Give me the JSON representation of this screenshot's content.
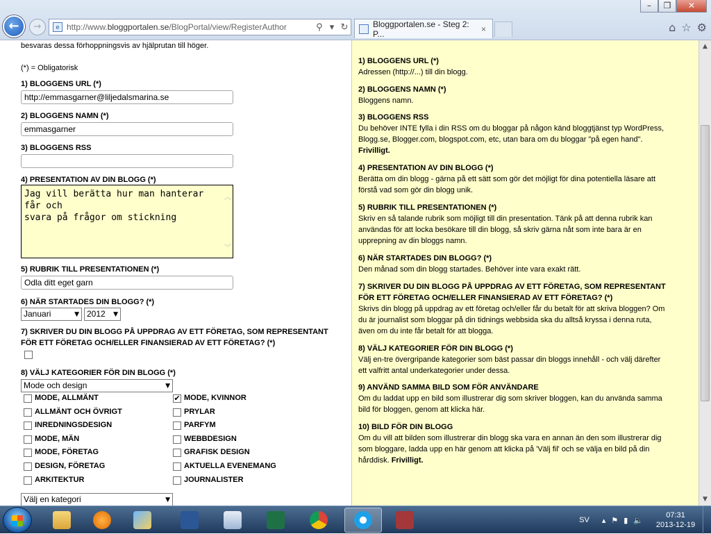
{
  "browser": {
    "url_prefix": "http://www.",
    "url_host": "bloggportalen.se",
    "url_path": "/BlogPortal/view/RegisterAuthor",
    "tab_title": "Bloggportalen.se - Steg 2: P...",
    "tab_close": "×"
  },
  "form": {
    "intro": "besvaras dessa förhoppningsvis av hjälprutan till höger.",
    "required_note": "(*) = Obligatorisk",
    "url_label": "1) BLOGGENS URL (*)",
    "url_value": "http://emmasgarner@liljedalsmarina.se",
    "name_label": "2) BLOGGENS NAMN (*)",
    "name_value": "emmasgarner",
    "rss_label": "3) BLOGGENS RSS",
    "rss_value": "",
    "presentation_label": "4) PRESENTATION AV DIN BLOGG (*)",
    "presentation_value": "Jag vill berätta hur man hanterar får och\nsvara på frågor om stickning",
    "title_label": "5) RUBRIK TILL PRESENTATIONEN (*)",
    "title_value": "Odla ditt eget garn",
    "started_label": "6) NÄR STARTADES DIN BLOGG? (*)",
    "month_value": "Januari",
    "year_value": "2012",
    "company_label_1": "7) SKRIVER DU DIN BLOGG PÅ UPPDRAG AV ETT FÖRETAG, SOM REPRESENTANT",
    "company_label_2": "FÖR ETT FÖRETAG OCH/ELLER FINANSIERAD AV ETT FÖRETAG? (*)",
    "categories_label": "8) VÄLJ KATEGORIER FÖR DIN BLOGG (*)",
    "main_category": "Mode och design",
    "subcategories": [
      {
        "label": "MODE, ALLMÄNT",
        "checked": false
      },
      {
        "label": "MODE, KVINNOR",
        "checked": true
      },
      {
        "label": "ALLMÄNT OCH ÖVRIGT",
        "checked": false
      },
      {
        "label": "PRYLAR",
        "checked": false
      },
      {
        "label": "INREDNINGSDESIGN",
        "checked": false
      },
      {
        "label": "PARFYM",
        "checked": false
      },
      {
        "label": "MODE, MÄN",
        "checked": false
      },
      {
        "label": "WEBBDESIGN",
        "checked": false
      },
      {
        "label": "MODE, FÖRETAG",
        "checked": false
      },
      {
        "label": "GRAFISK DESIGN",
        "checked": false
      },
      {
        "label": "DESIGN, FÖRETAG",
        "checked": false
      },
      {
        "label": "AKTUELLA EVENEMANG",
        "checked": false
      },
      {
        "label": "ARKITEKTUR",
        "checked": false
      },
      {
        "label": "JOURNALISTER",
        "checked": false
      }
    ],
    "choose_category": "Välj en kategori"
  },
  "help": [
    {
      "heading": "1) BLOGGENS URL (*)",
      "body": "Adressen (http://...) till din blogg.",
      "bold_tail": ""
    },
    {
      "heading": "2) BLOGGENS NAMN (*)",
      "body": "Bloggens namn.",
      "bold_tail": ""
    },
    {
      "heading": "3) BLOGGENS RSS",
      "body": "Du behöver INTE fylla i din RSS om du bloggar på någon känd bloggtjänst typ WordPress, Blogg.se, Blogger.com, blogspot.com, etc, utan bara om du bloggar \"på egen hand\". ",
      "bold_tail": "Frivilligt."
    },
    {
      "heading": "4) PRESENTATION AV DIN BLOGG (*)",
      "body": "Berätta om din blogg - gärna på ett sätt som gör det möjligt för dina potentiella läsare att förstå vad som gör din blogg unik.",
      "bold_tail": ""
    },
    {
      "heading": "5) RUBRIK TILL PRESENTATIONEN (*)",
      "body": "Skriv en så talande rubrik som möjligt till din presentation. Tänk på att denna rubrik kan användas för att locka besökare till din blogg, så skriv gärna nåt som inte bara är en upprepning av din bloggs namn.",
      "bold_tail": ""
    },
    {
      "heading": "6) NÄR STARTADES DIN BLOGG? (*)",
      "body": "Den månad som din blogg startades. Behöver inte vara exakt rätt.",
      "bold_tail": ""
    },
    {
      "heading": "7) SKRIVER DU DIN BLOGG PÅ UPPDRAG AV ETT FÖRETAG, SOM REPRESENTANT FÖR ETT FÖRETAG OCH/ELLER FINANSIERAD AV ETT FÖRETAG? (*)",
      "body": "Skrivs din blogg på uppdrag av ett företag och/eller får du betalt för att skriva bloggen? Om du är journalist som bloggar på din tidnings webbsida ska du alltså kryssa i denna ruta, även om du inte får betalt för att blogga.",
      "bold_tail": ""
    },
    {
      "heading": "8) VÄLJ KATEGORIER FÖR DIN BLOGG (*)",
      "body": "Välj en-tre övergripande kategorier som bäst passar din bloggs innehåll - och välj därefter ett valfritt antal underkategorier under dessa.",
      "bold_tail": ""
    },
    {
      "heading": "9) ANVÄND SAMMA BILD SOM FÖR ANVÄNDARE",
      "body": "Om du laddat upp en bild som illustrerar dig som skriver bloggen, kan du använda samma bild för bloggen, genom att klicka här.",
      "bold_tail": ""
    },
    {
      "heading": "10) BILD FÖR DIN BLOGG",
      "body": "Om du vill att bilden som illustrerar din blogg ska vara en annan än den som illustrerar dig som bloggare, ladda upp en här genom att klicka på 'Välj fil' och se välja en bild på din hårddisk. ",
      "bold_tail": "Frivilligt."
    }
  ],
  "taskbar": {
    "language": "SV",
    "time": "07:31",
    "date": "2013-12-19"
  }
}
